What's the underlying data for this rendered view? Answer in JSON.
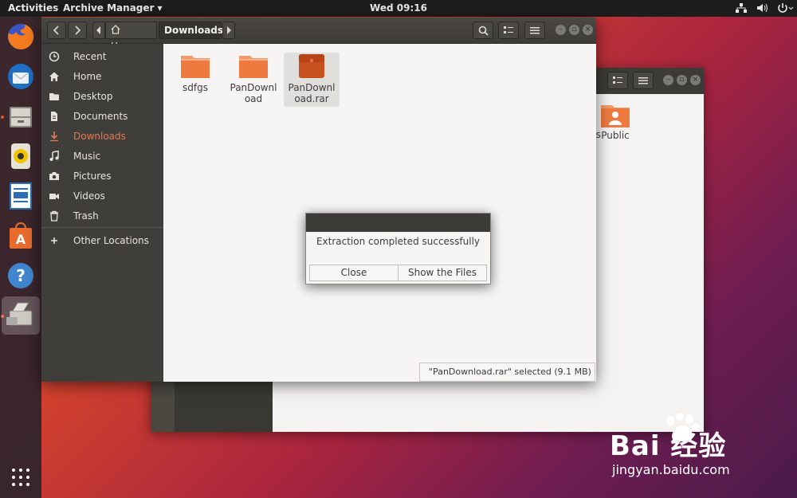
{
  "topbar": {
    "activities": "Activities",
    "app_menu": "Archive Manager",
    "clock": "Wed 09:16"
  },
  "dock": {
    "items": [
      "firefox",
      "thunderbird",
      "files",
      "rhythmbox",
      "libreoffice-writer",
      "software-center",
      "help",
      "archive-manager"
    ],
    "show_apps": "apps-grid"
  },
  "window": {
    "breadcrumb": [
      "Home",
      "Downloads"
    ]
  },
  "sidebar": {
    "items": [
      {
        "label": "Recent",
        "icon": "clock-icon"
      },
      {
        "label": "Home",
        "icon": "home-icon"
      },
      {
        "label": "Desktop",
        "icon": "folder-icon"
      },
      {
        "label": "Documents",
        "icon": "document-icon"
      },
      {
        "label": "Downloads",
        "icon": "download-icon"
      },
      {
        "label": "Music",
        "icon": "music-icon"
      },
      {
        "label": "Pictures",
        "icon": "camera-icon"
      },
      {
        "label": "Videos",
        "icon": "video-icon"
      },
      {
        "label": "Trash",
        "icon": "trash-icon"
      }
    ],
    "other": "Other Locations"
  },
  "files": [
    {
      "name": "sdfgs",
      "type": "folder"
    },
    {
      "name": "PanDownload",
      "type": "folder"
    },
    {
      "name": "PanDownload.rar",
      "type": "archive"
    }
  ],
  "background_window": {
    "files": [
      {
        "name": "ures",
        "type": "folder"
      },
      {
        "name": "Public",
        "type": "folder"
      }
    ]
  },
  "status": "\"PanDownload.rar\" selected  (9.1 MB)",
  "dialog": {
    "message": "Extraction completed successfully",
    "close": "Close",
    "show_files": "Show the Files"
  },
  "watermark": {
    "brand": "Bai 经验",
    "url": "jingyan.baidu.com"
  },
  "colors": {
    "accent": "#e95420",
    "header": "#3d3b37",
    "sidebar": "#403e3a"
  }
}
